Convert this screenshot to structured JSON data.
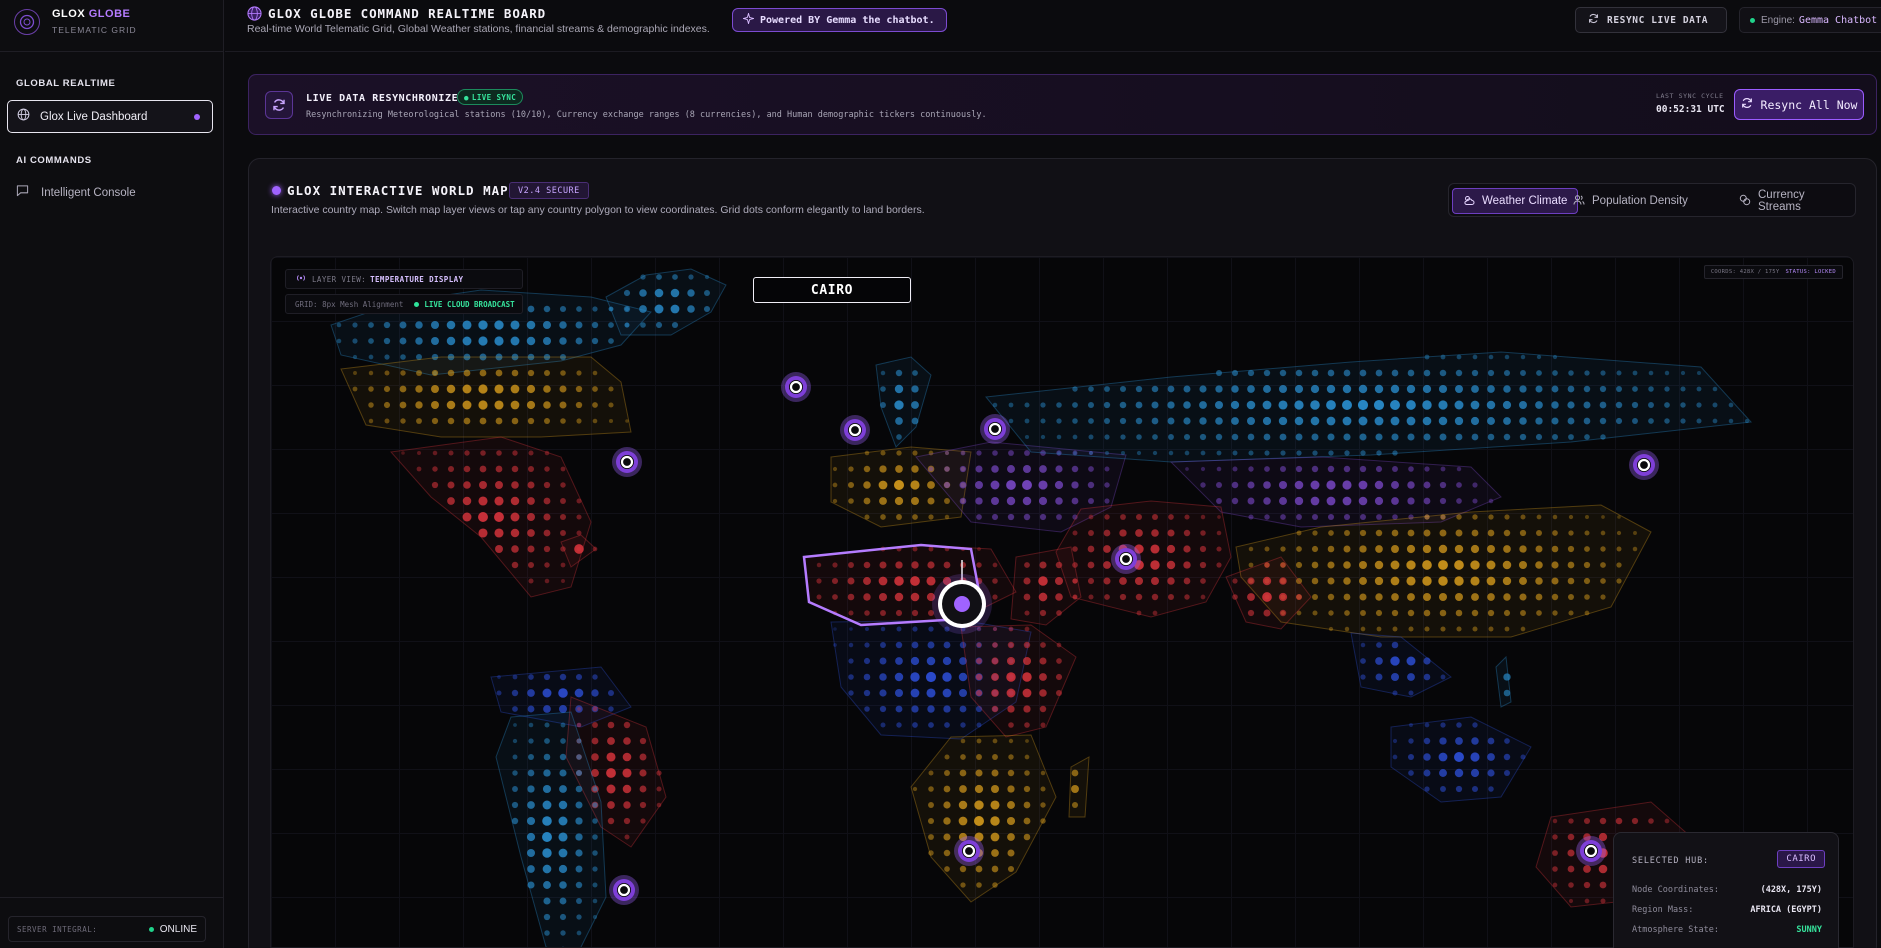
{
  "sidebar": {
    "brand": {
      "name_part1": "GLOX",
      "name_part2": "GLOBE",
      "subtitle": "TELEMATIC GRID"
    },
    "sections": [
      {
        "label": "GLOBAL REALTIME",
        "items": [
          {
            "label": "Glox Live Dashboard",
            "icon": "globe-icon",
            "active": true
          }
        ]
      },
      {
        "label": "AI COMMANDS",
        "items": [
          {
            "label": "Intelligent Console",
            "icon": "chat-icon",
            "active": false
          }
        ]
      }
    ],
    "server": {
      "label": "SERVER INTEGRAL:",
      "status": "ONLINE"
    }
  },
  "header": {
    "title": "GLOX GLOBE COMMAND REALTIME BOARD",
    "subtitle": "Real-time World Telematic Grid, Global Weather stations, financial streams & demographic indexes.",
    "powered_by": "Powered BY Gemma the chatbot.",
    "resync_button": "RESYNC LIVE DATA",
    "engine_label": "Engine:",
    "engine_value": "Gemma Chatbot"
  },
  "resync_banner": {
    "title": "LIVE DATA RESYNCHRONIZER",
    "badge": "LIVE SYNC",
    "description": "Resynchronizing Meteorological stations (10/10), Currency exchange ranges (8 currencies), and Human demographic tickers continuously.",
    "last_sync_label": "LAST SYNC CYCLE",
    "last_sync_time": "00:52:31 UTC",
    "button": "Resync All Now"
  },
  "map_panel": {
    "title": "GLOX INTERACTIVE WORLD MAP",
    "version": "V2.4 SECURE",
    "subtitle": "Interactive country map. Switch map layer views or tap any country polygon to view coordinates. Grid dots conform elegantly to land borders.",
    "tabs": [
      {
        "label": "Weather Climate",
        "icon": "weather-icon",
        "active": true
      },
      {
        "label": "Population Density",
        "icon": "people-icon",
        "active": false
      },
      {
        "label": "Currency Streams",
        "icon": "coins-icon",
        "active": false
      }
    ],
    "layer_view_label": "LAYER VIEW:",
    "layer_view_value": "TEMPERATURE DISPLAY",
    "grid_label": "GRID: 8px Mesh Alignment",
    "broadcast": "LIVE CLOUD BROADCAST",
    "coords_text": "COORDS: 428X / 175Y",
    "coords_status": "STATUS: LOCKED",
    "selected_label": "CAIRO",
    "hub_card": {
      "title": "SELECTED HUB:",
      "hub": "CAIRO",
      "rows": [
        {
          "key": "Node Coordinates:",
          "value": "(428X, 175Y)"
        },
        {
          "key": "Region Mass:",
          "value": "AFRICA (EGYPT)"
        },
        {
          "key": "Atmosphere State:",
          "value": "SUNNY"
        }
      ]
    }
  },
  "colors": {
    "accent": "#a063ff",
    "cold": "#2a8fd0",
    "freezing": "#2d4fd8",
    "mild": "#d49a1c",
    "hot": "#d8343c",
    "cool": "#7a48c8",
    "live": "#36e39c"
  }
}
